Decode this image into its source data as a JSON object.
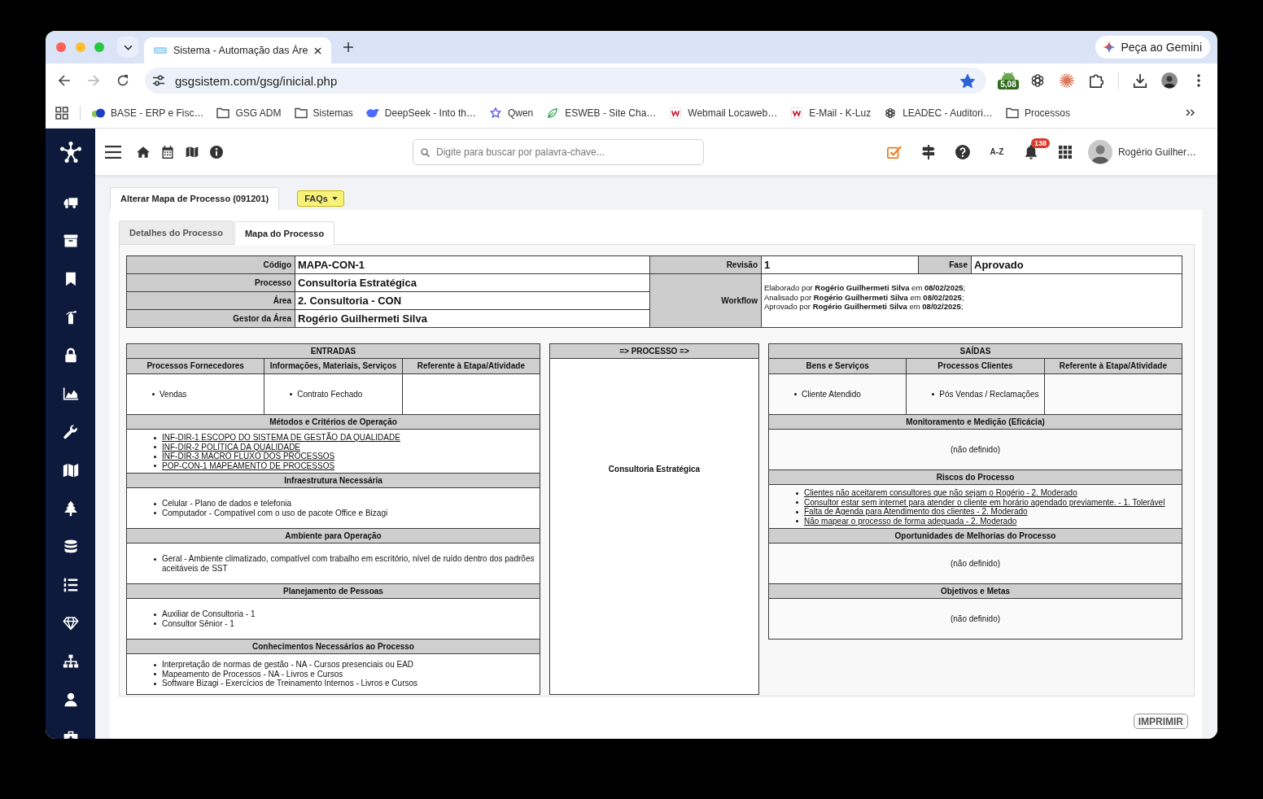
{
  "browser": {
    "tabs": [
      {
        "title": "Sistema - Automação das Áre",
        "selected": true
      }
    ],
    "gemini_button": "Peça ao Gemini",
    "forward_disabled": true,
    "url": "gsgsistem.com/gsg/inicial.php",
    "bookmarked": true,
    "extension_badge": "5,08",
    "bookmarks": [
      {
        "label": "BASE - ERP e Fisc…",
        "kind": "blob"
      },
      {
        "label": "GSG ADM",
        "kind": "folder"
      },
      {
        "label": "Sistemas",
        "kind": "folder"
      },
      {
        "label": "DeepSeek - Into th…",
        "kind": "whale"
      },
      {
        "label": "Qwen",
        "kind": "star"
      },
      {
        "label": "ESWEB - Site Cha…",
        "kind": "leaf"
      },
      {
        "label": "Webmail Locaweb…",
        "kind": "zigzag"
      },
      {
        "label": "E-Mail - K-Luz",
        "kind": "zigzag"
      },
      {
        "label": "LEADEC - Auditori…",
        "kind": "knot"
      },
      {
        "label": "Processos",
        "kind": "folder"
      }
    ]
  },
  "app": {
    "search_placeholder": "Digite para buscar por palavra-chave...",
    "az_button": "A-Z",
    "notification_count": "138",
    "user_name": "Rogério Guilher…"
  },
  "page_tab": {
    "title": "Alterar Mapa de Processo (091201)"
  },
  "faqs_button": "FAQs",
  "tabs": [
    {
      "label": "Detalhes do Processo",
      "selected": false
    },
    {
      "label": "Mapa do Processo",
      "selected": true
    }
  ],
  "summary": {
    "rows": [
      {
        "label": "Código",
        "value": "MAPA-CON-1"
      },
      {
        "label": "Processo",
        "value": "Consultoria Estratégica"
      },
      {
        "label": "Área",
        "value": "2. Consultoria - CON"
      },
      {
        "label": "Gestor da Área",
        "value": "Rogério Guilhermeti Silva"
      }
    ],
    "revision": {
      "label": "Revisão",
      "value": "1"
    },
    "phase": {
      "label": "Fase",
      "value": "Aprovado"
    },
    "workflow": {
      "label": "Workflow",
      "lines": [
        "Elaborado por **Rogério Guilhermeti Silva** em **08/02/2025**;",
        "Analisado por **Rogério Guilhermeti Silva** em **08/02/2025**;",
        "Aprovado por **Rogério Guilhermeti Silva** em **08/02/2025**;"
      ]
    }
  },
  "inputs": {
    "title": "ENTRADAS",
    "columns": [
      "Processos Fornecedores",
      "Informações, Materiais, Serviços",
      "Referente à Etapa/Atividade"
    ],
    "cells": [
      [
        "Vendas"
      ],
      [
        "Contrato Fechado"
      ]
    ],
    "sections": [
      {
        "title": "Métodos e Critérios de Operação",
        "kind": "links",
        "items": [
          "INF-DIR-1 ESCOPO DO SISTEMA DE GESTÃO DA QUALIDADE",
          "INF-DIR-2 POLÍTICA DA QUALIDADE",
          "INF-DIR-3 MACRO FLUXO DOS PROCESSOS",
          "POP-CON-1 MAPEAMENTO DE PROCESSOS"
        ]
      },
      {
        "title": "Infraestrutura Necessária",
        "kind": "list",
        "items": [
          "Celular - Plano de dados e telefonia",
          "Computador - Compatível com o uso de pacote Office e Bizagi"
        ]
      },
      {
        "title": "Ambiente para Operação",
        "kind": "list",
        "items": [
          "Geral - Ambiente climatizado, compatível com trabalho em escritório, nível de ruído dentro dos padrões aceitáveis de SST"
        ]
      },
      {
        "title": "Planejamento de Pessoas",
        "kind": "list",
        "items": [
          "Auxiliar de Consultoria - 1",
          "Consultor Sênior - 1"
        ]
      },
      {
        "title": "Conhecimentos Necessários ao Processo",
        "kind": "list",
        "items": [
          "Interpretação de normas de gestão - NA - Cursos presenciais ou EAD",
          "Mapeamento de Processos - NA - Livros e Cursos",
          "Software Bizagi - Exercícios de Treinamento Internos - Livros e Cursos"
        ]
      }
    ]
  },
  "process": {
    "title": "=> PROCESSO =>",
    "name": "Consultoria Estratégica"
  },
  "outputs": {
    "title": "SAÍDAS",
    "columns": [
      "Bens e Serviços",
      "Processos Clientes",
      "Referente à Etapa/Atividade"
    ],
    "cells": [
      [
        "Cliente Atendido"
      ],
      [
        "Pós Vendas / Reclamações"
      ]
    ],
    "sections": [
      {
        "title": "Monitoramento e Medição (Eficácia)",
        "kind": "note",
        "text": "(não definido)"
      },
      {
        "title": "Riscos do Processo",
        "kind": "links",
        "items": [
          "Clientes não aceitarem consultores que não sejam o Rogério - 2. Moderado",
          "Consultor estar sem internet para atender o cliente em horário agendado previamente. - 1. Tolerável",
          "Falta de Agenda para Atendimento dos clientes - 2. Moderado",
          "Não mapear o processo de forma adequada - 2. Moderado"
        ]
      },
      {
        "title": "Oportunidades de Melhorias do Processo",
        "kind": "note",
        "text": "(não definido)"
      },
      {
        "title": "Objetivos e Metas",
        "kind": "note",
        "text": "(não definido)"
      }
    ]
  },
  "print_button": "IMPRIMIR"
}
